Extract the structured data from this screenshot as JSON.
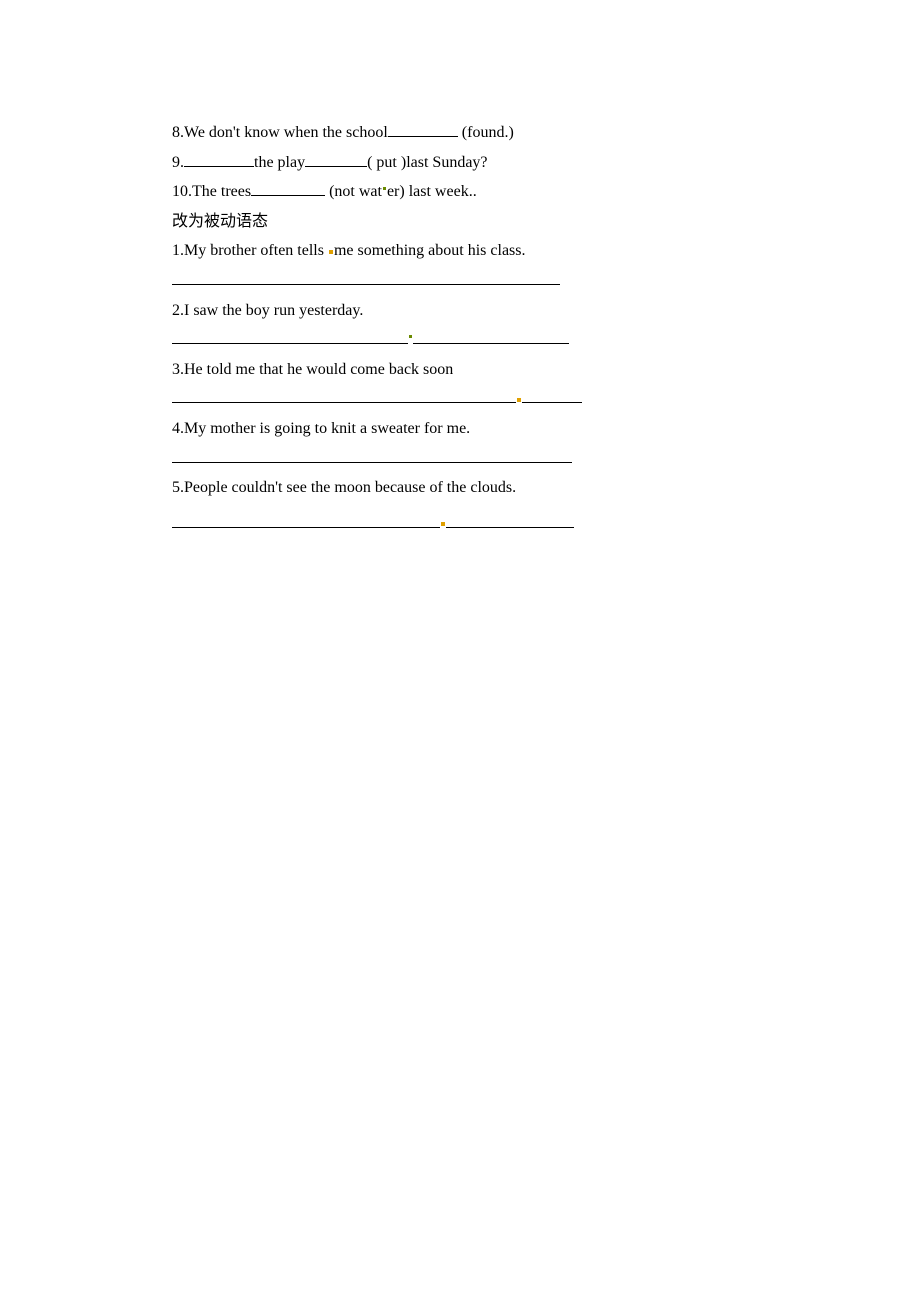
{
  "fill": {
    "q8_a": "8.We don't know when the school",
    "q8_b": " (found.)",
    "q9_a": "9.",
    "q9_b": "the play",
    "q9_c": "( put )last Sunday?",
    "q10_a": "10.The trees",
    "q10_b": " (not wat",
    "q10_c": "er) last week..",
    "heading": "改为被动语态",
    "q1_a": "1.My brother often tells  ",
    "q1_b": "me something about his class.",
    "q2": "2.I saw the boy run yesterday.",
    "q3": "3.He told me that he would come back soon",
    "q4": "4.My mother is going to knit a sweater for me.",
    "q5": "5.People couldn't see the moon because of the clouds."
  }
}
